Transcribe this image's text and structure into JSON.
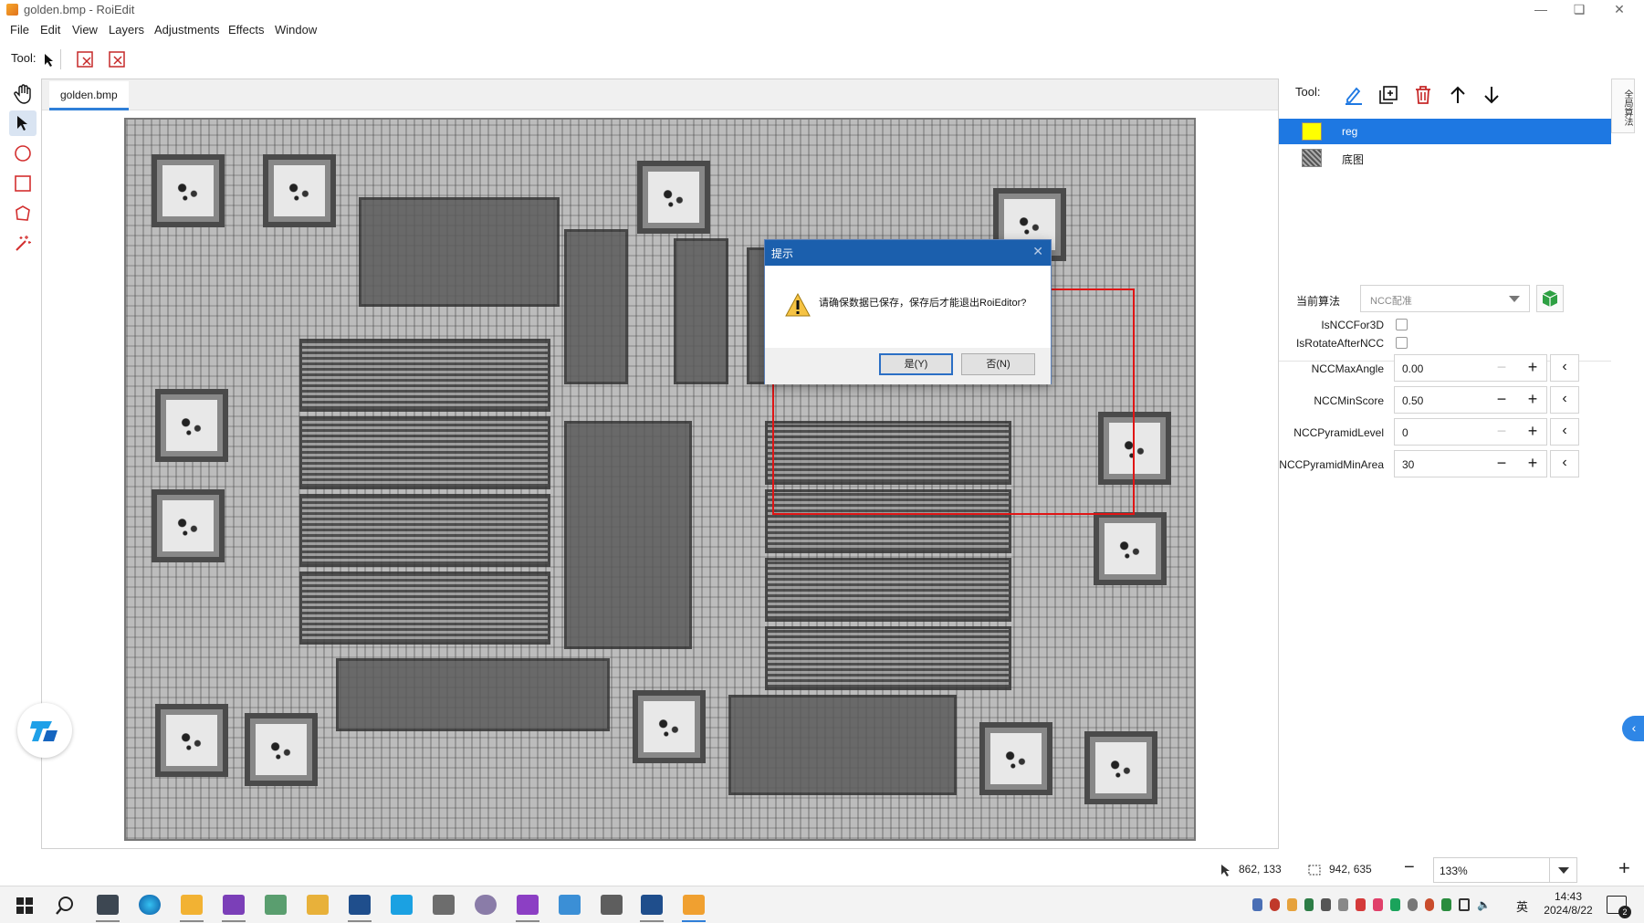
{
  "window": {
    "title": "golden.bmp - RoiEdit"
  },
  "menu": [
    "File",
    "Edit",
    "View",
    "Layers",
    "Adjustments",
    "Effects",
    "Window"
  ],
  "toolbar": {
    "label": "Tool:"
  },
  "doc": {
    "tab": "golden.bmp"
  },
  "dialog": {
    "title": "提示",
    "message": "请确保数据已保存，保存后才能退出RoiEditor?",
    "yes": "是(Y)",
    "no": "否(N)"
  },
  "panel": {
    "tool_label": "Tool:",
    "layers": [
      {
        "name": "reg",
        "swatch": "#ffff00",
        "selected": true
      },
      {
        "name": "底图",
        "swatch": "#888888",
        "selected": false
      }
    ],
    "algo_label": "当前算法",
    "algo_value": "NCC配准",
    "params": {
      "is_ncc_for_3d": "IsNCCFor3D",
      "is_rotate_after_ncc": "IsRotateAfterNCC",
      "ncc_max_angle": {
        "label": "NCCMaxAngle",
        "value": "0.00"
      },
      "ncc_min_score": {
        "label": "NCCMinScore",
        "value": "0.50"
      },
      "ncc_pyramid_level": {
        "label": "NCCPyramidLevel",
        "value": "0"
      },
      "ncc_pyramid_min_area": {
        "label": "NCCPyramidMinArea",
        "value": "30"
      }
    },
    "side_tab": "全局算法"
  },
  "status": {
    "cursor_pos": "862, 133",
    "selection_size": "942, 635",
    "zoom": "133%"
  },
  "taskbar": {
    "ime": "英",
    "time": "14:43",
    "date": "2024/8/22",
    "notification_count": "2"
  },
  "colors": {
    "accent": "#1e78e2",
    "dialog_title": "#1b5fad",
    "roi": "#e01515"
  }
}
